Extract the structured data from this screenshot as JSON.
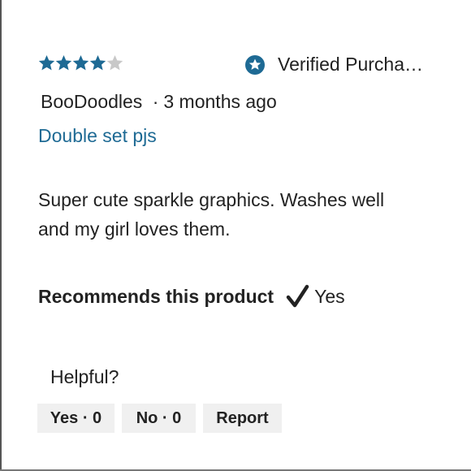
{
  "review": {
    "rating": 4,
    "rating_max": 5,
    "star_color": "#1e6a94",
    "star_empty_color": "#c8c8c8",
    "verified_label": "Verified Purcha…",
    "author": "BooDoodles",
    "separator": "·",
    "date": "3 months ago",
    "title": "Double set pjs",
    "body": "Super cute sparkle graphics. Washes well and my girl loves them.",
    "recommend_label": "Recommends this product",
    "recommend_icon": "check-icon",
    "recommend_value": "Yes"
  },
  "helpful": {
    "label": "Helpful?",
    "yes_label": "Yes · 0",
    "no_label": "No · 0",
    "report_label": "Report"
  }
}
